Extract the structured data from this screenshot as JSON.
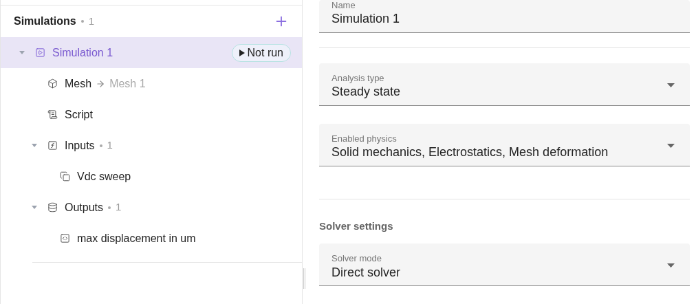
{
  "sidebar": {
    "title": "Simulations",
    "count": "1",
    "tree": [
      {
        "kind": "simulation",
        "label": "Simulation 1",
        "selected": true,
        "expanded": true,
        "badge": "Not run",
        "children": [
          {
            "kind": "mesh",
            "label": "Mesh",
            "target": "Mesh 1",
            "selected": false
          },
          {
            "kind": "script",
            "label": "Script",
            "selected": false
          },
          {
            "kind": "inputs",
            "label": "Inputs",
            "count": "1",
            "selected": false,
            "expanded": true,
            "children": [
              {
                "kind": "sweep",
                "label": "Vdc sweep",
                "selected": false
              }
            ]
          },
          {
            "kind": "outputs",
            "label": "Outputs",
            "count": "1",
            "selected": false,
            "expanded": true,
            "children": [
              {
                "kind": "output",
                "label": "max displacement in um",
                "selected": false
              }
            ]
          }
        ]
      }
    ]
  },
  "form": [
    {
      "kind": "text",
      "label": "Name",
      "value": "Simulation 1"
    },
    {
      "kind": "divider"
    },
    {
      "kind": "select",
      "label": "Analysis type",
      "value": "Steady state"
    },
    {
      "kind": "select",
      "label": "Enabled physics",
      "value": "Solid mechanics, Electrostatics, Mesh deformation"
    },
    {
      "kind": "divider"
    },
    {
      "kind": "heading",
      "label": "Solver settings"
    },
    {
      "kind": "select",
      "label": "Solver mode",
      "value": "Direct solver"
    }
  ]
}
